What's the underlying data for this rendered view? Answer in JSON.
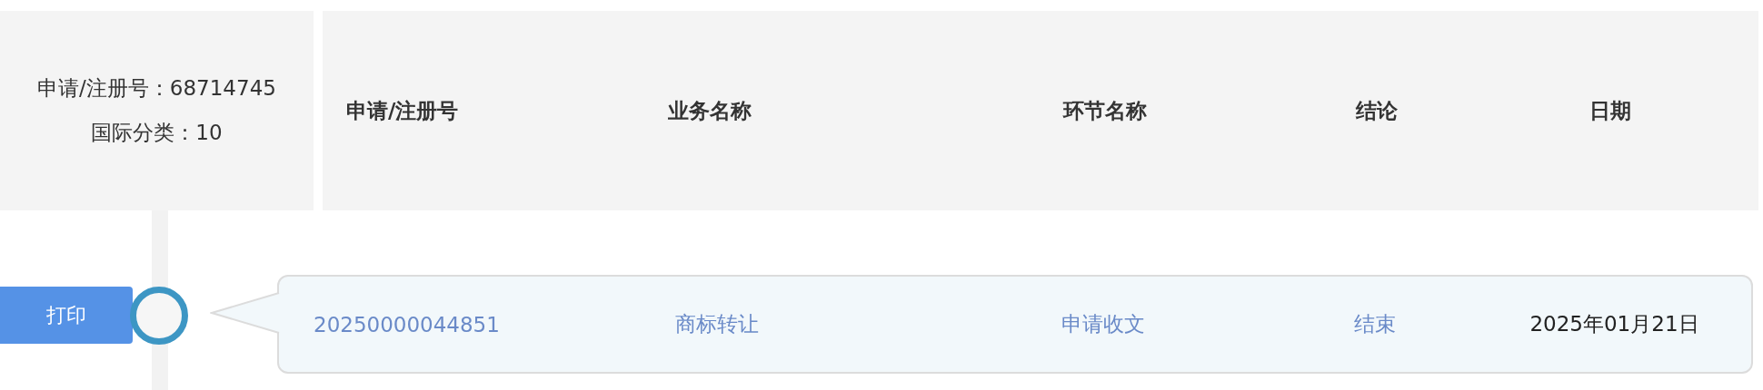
{
  "summary": {
    "lines": [
      "申请/注册号：68714745",
      "国际分类：10"
    ]
  },
  "table": {
    "columns": [
      "申请/注册号",
      "业务名称",
      "环节名称",
      "结论",
      "日期"
    ],
    "rows": [
      {
        "cells": [
          {
            "text": "20250000044851",
            "kind": "link"
          },
          {
            "text": "商标转让",
            "kind": "link"
          },
          {
            "text": "申请收文",
            "kind": "link"
          },
          {
            "text": "结束",
            "kind": "link"
          },
          {
            "text": "2025年01月21日",
            "kind": "text"
          }
        ]
      }
    ]
  },
  "print_button": {
    "label": "打印"
  }
}
